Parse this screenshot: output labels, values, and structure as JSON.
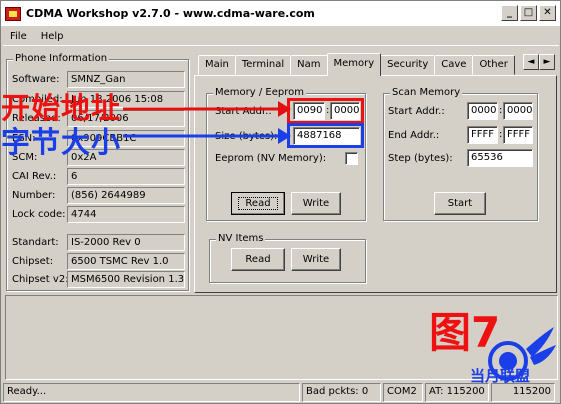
{
  "window": {
    "title": "CDMA Workshop v2.7.0 - www.cdma-ware.com"
  },
  "titlebar_buttons": {
    "minimize": "_",
    "maximize": "□",
    "close": "✕"
  },
  "menu": [
    "File",
    "Help"
  ],
  "phone_info": {
    "group_label": "Phone Information",
    "fields": [
      {
        "label": "Software:",
        "value": "SMNZ_Gan"
      },
      {
        "label": "Compiled:",
        "value": "Jun 18 2006 15:08"
      },
      {
        "label": "Released:",
        "value": "06/17/2006"
      },
      {
        "label": "ESN:",
        "value": "0x909CBB1C"
      },
      {
        "label": "SCM:",
        "value": "0x2A"
      },
      {
        "label": "CAI Rev.:",
        "value": "6"
      },
      {
        "label": "Number:",
        "value": "(856) 2644989"
      },
      {
        "label": "Lock code:",
        "value": "4744"
      },
      {
        "label": "Standart:",
        "value": "IS-2000 Rev 0"
      },
      {
        "label": "Chipset:",
        "value": "6500 TSMC Rev 1.0"
      },
      {
        "label": "Chipset v2:",
        "value": "MSM6500 Revision 1.3"
      }
    ]
  },
  "tabs": [
    "Main",
    "Terminal",
    "Nam",
    "Memory",
    "Security",
    "Cave",
    "Other"
  ],
  "active_tab": "Memory",
  "tab_arrows": {
    "left": "◄",
    "right": "►"
  },
  "memory_eeprom": {
    "group_label": "Memory / Eeprom",
    "start_addr_label": "Start Addr.:",
    "start_addr_hi": "0090",
    "start_addr_lo": "0000",
    "size_label": "Size (bytes):",
    "size_value": "4887168",
    "eeprom_label": "Eeprom (NV Memory):",
    "read_label": "Read",
    "write_label": "Write"
  },
  "nv_items": {
    "group_label": "NV Items",
    "read_label": "Read",
    "write_label": "Write"
  },
  "scan_memory": {
    "group_label": "Scan Memory",
    "start_label": "Start Addr.:",
    "start_hi": "0000",
    "start_lo": "0000",
    "end_label": "End Addr.:",
    "end_hi": "FFFF",
    "end_lo": "FFFF",
    "step_label": "Step (bytes):",
    "step_value": "65536",
    "start_button": "Start"
  },
  "annotations": {
    "start_address_cn": "开始地址",
    "byte_size_cn": "字节大小",
    "figure_label": "图7",
    "watermark_text": "当月联盟"
  },
  "status": {
    "ready": "Ready...",
    "bad_packets": "Bad pckts: 0",
    "port": "COM2",
    "at_speed": "AT: 115200",
    "speed2": "115200"
  },
  "colors": {
    "annotation_red": "#e11111",
    "annotation_blue": "#1a3ee8",
    "window_bg": "#d4d0c8"
  }
}
